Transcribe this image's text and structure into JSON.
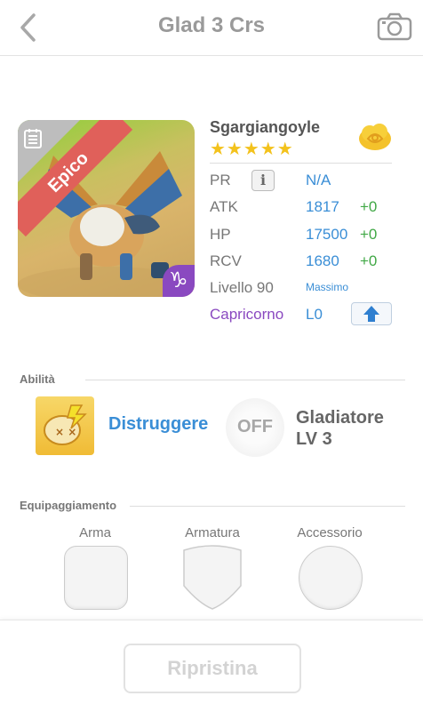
{
  "header": {
    "title": "Glad 3 Crs",
    "back_icon": "chevron-left-icon",
    "camera_icon": "camera-icon"
  },
  "monster": {
    "rarity": "Epico",
    "name": "Sgargiangoyle",
    "stars": "★★★★★",
    "star_count": 5,
    "zodiac_symbol": "♑",
    "stats": {
      "pr_label": "PR",
      "pr_value": "N/A",
      "info_glyph": "i",
      "atk_label": "ATK",
      "atk_value": "1817",
      "atk_plus": "+0",
      "hp_label": "HP",
      "hp_value": "17500",
      "hp_plus": "+0",
      "rcv_label": "RCV",
      "rcv_value": "1680",
      "rcv_plus": "+0",
      "level_label": "Livello 90",
      "level_status": "Massimo",
      "sign_label": "Capricorno",
      "sign_value": "L0"
    }
  },
  "abilities": {
    "section_label": "Abilità",
    "active_name": "Distruggere",
    "off_text": "OFF",
    "passive_line1": "Gladiatore",
    "passive_line2": "LV 3"
  },
  "equipment": {
    "section_label": "Equipaggiamento",
    "weapon_label": "Arma",
    "armor_label": "Armatura",
    "accessory_label": "Accessorio"
  },
  "footer": {
    "reset_label": "Ripristina"
  },
  "colors": {
    "accent_blue": "#3a8ed6",
    "plus_green": "#41a846",
    "star_yellow": "#f3c21c",
    "epic_red": "#e0605a",
    "zodiac_purple": "#8a49c0"
  }
}
